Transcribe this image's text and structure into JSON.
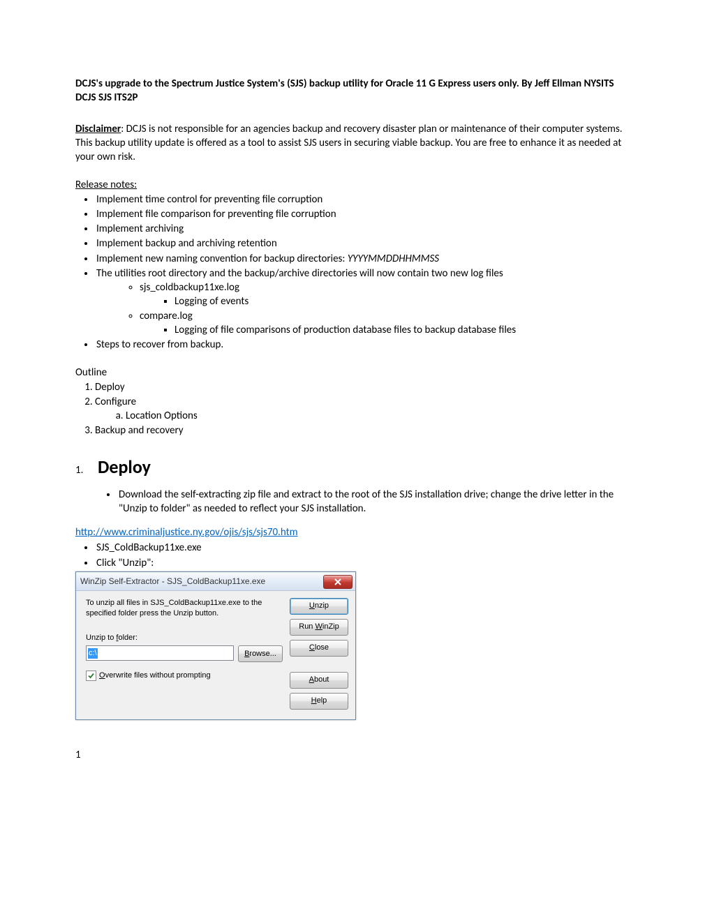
{
  "title": "DCJS's upgrade to the Spectrum Justice System's (SJS) backup utility for Oracle 11 G Express users only.  By Jeff Ellman NYSITS DCJS SJS ITS2P",
  "disclaimer": {
    "label": "Disclaimer",
    "text": ":  DCJS is not responsible for an agencies backup and recovery disaster plan or maintenance of their computer systems.  This backup utility update is offered as a tool to assist SJS users in securing viable backup.   You are free to enhance it as needed at your own risk."
  },
  "release_notes_label": "Release notes:  ",
  "release_notes": [
    "Implement time control for preventing file corruption",
    "Implement file comparison for preventing file corruption",
    "Implement archiving",
    "Implement backup and archiving retention"
  ],
  "naming_prefix": "Implement new naming convention for backup directories:  ",
  "naming_italic": "YYYYMMDDHHMMSS",
  "util_root": "The utilities root directory and the backup/archive directories will now contain two new log files",
  "log1": "sjs_coldbackup11xe.log",
  "log1_desc": "Logging of events",
  "log2": "compare.log",
  "log2_desc": "Logging of file comparisons of production database files to backup database files",
  "steps_recover": "Steps to recover from backup.",
  "outline_label": "Outline",
  "outline": {
    "o1": "Deploy",
    "o2": "Configure",
    "o2a": "Location Options",
    "o3": "Backup and recovery"
  },
  "deploy": {
    "num": "1.",
    "heading": "Deploy",
    "bullet1": "Download the self-extracting zip file and extract to the root of the SJS installation drive; change the drive letter in the \"Unzip to folder\" as needed to reflect your SJS installation.",
    "link": "http://www.criminaljustice.ny.gov/ojis/sjs/sjs70.htm",
    "bullet2": "SJS_ColdBackup11xe.exe",
    "bullet3": "Click \"Unzip\":"
  },
  "dialog": {
    "title": "WinZip Self-Extractor - SJS_ColdBackup11xe.exe",
    "instr": "To unzip all files in SJS_ColdBackup11xe.exe to the specified folder press the Unzip button.",
    "unzip_label_pre": "Unzip to ",
    "unzip_label_u": "f",
    "unzip_label_post": "older:",
    "folder_value": "c:\\",
    "browse_u": "B",
    "browse_post": "rowse...",
    "overwrite_u": "O",
    "overwrite_post": "verwrite files without prompting",
    "btn_unzip_u": "U",
    "btn_unzip_post": "nzip",
    "btn_runwz_pre": "Run ",
    "btn_runwz_u": "W",
    "btn_runwz_post": "inZip",
    "btn_close_u": "C",
    "btn_close_post": "lose",
    "btn_about_u": "A",
    "btn_about_post": "bout",
    "btn_help_u": "H",
    "btn_help_post": "elp"
  },
  "page_number": "1"
}
